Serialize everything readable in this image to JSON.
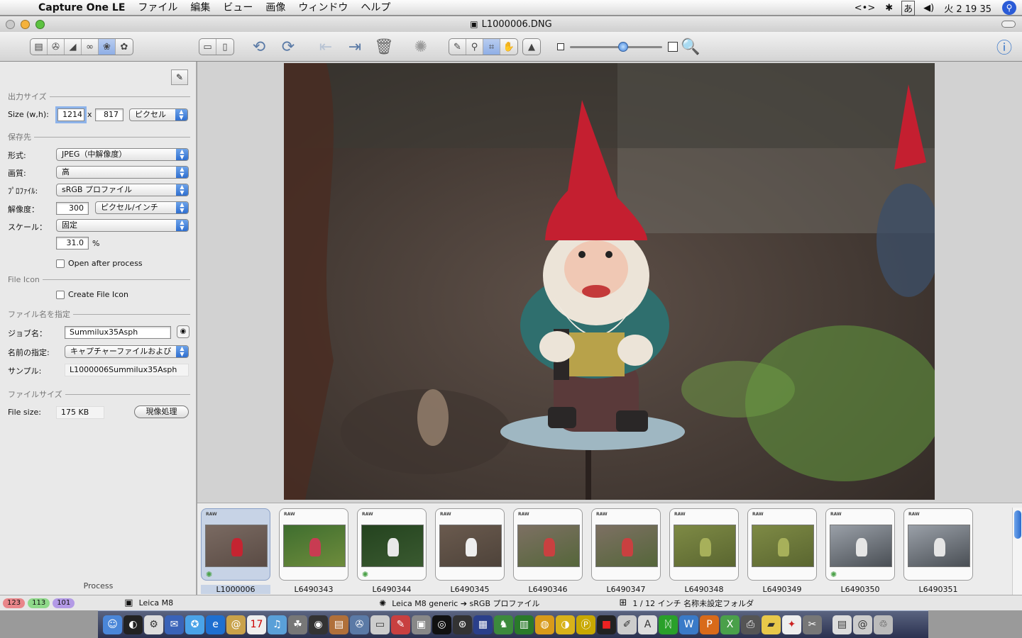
{
  "menubar": {
    "app_name": "Capture One LE",
    "items": [
      "ファイル",
      "編集",
      "ビュー",
      "画像",
      "ウィンドウ",
      "ヘルプ"
    ],
    "clock": "火 2 19 35",
    "input_mode": "あ"
  },
  "window": {
    "title": "L1000006.DNG"
  },
  "sidebar": {
    "output_size": {
      "section": "出力サイズ",
      "label": "Size (w,h):",
      "width": "1214",
      "sep": "x",
      "height": "817",
      "unit": "ピクセル"
    },
    "destination": {
      "section": "保存先",
      "format_label": "形式:",
      "format": "JPEG（中解像度）",
      "quality_label": "画質:",
      "quality": "高",
      "profile_label": "ﾌﾟﾛﾌｧｲﾙ:",
      "profile": "sRGB プロファイル",
      "resolution_label": "解像度：",
      "resolution": "300",
      "resolution_unit": "ピクセル/インチ",
      "scale_label": "スケール：",
      "scale": "固定",
      "scale_percent": "31.0",
      "percent_sign": "%",
      "open_after": "Open after process"
    },
    "file_icon": {
      "section": "File Icon",
      "create": "Create File Icon"
    },
    "naming": {
      "section": "ファイル名を指定",
      "job_label": "ジョブ名：",
      "job_name": "Summilux35Asph",
      "naming_label": "名前の指定:",
      "naming_value": "キャプチャーファイルおよび",
      "sample_label": "サンプル:",
      "sample": "L1000006Summilux35Asph"
    },
    "file_size": {
      "section": "ファイルサイズ",
      "label": "File size:",
      "value": "175 KB",
      "process_button": "現像処理"
    },
    "footer": "Process"
  },
  "filmstrip": {
    "raw_tag": "RAW",
    "thumbs": [
      {
        "name": "L1000006",
        "selected": true,
        "processed": true,
        "colors": [
          "#7a6a62",
          "#c52431",
          "#5a4b44"
        ]
      },
      {
        "name": "L6490343",
        "selected": false,
        "processed": false,
        "colors": [
          "#3f6e2f",
          "#c83c52",
          "#6e8c3c"
        ]
      },
      {
        "name": "L6490344",
        "selected": false,
        "processed": true,
        "colors": [
          "#24431f",
          "#e8e8e8",
          "#3a5a30"
        ]
      },
      {
        "name": "L6490345",
        "selected": false,
        "processed": false,
        "colors": [
          "#6a5a4e",
          "#eeeeee",
          "#4e433a"
        ]
      },
      {
        "name": "L6490346",
        "selected": false,
        "processed": false,
        "colors": [
          "#7d7063",
          "#c94040",
          "#55663a"
        ]
      },
      {
        "name": "L6490347",
        "selected": false,
        "processed": false,
        "colors": [
          "#7d7063",
          "#c94040",
          "#55663a"
        ]
      },
      {
        "name": "L6490348",
        "selected": false,
        "processed": false,
        "colors": [
          "#7e8a45",
          "#a7b05a",
          "#5a6630"
        ]
      },
      {
        "name": "L6490349",
        "selected": false,
        "processed": false,
        "colors": [
          "#7e8a45",
          "#a7b05a",
          "#5a6630"
        ]
      },
      {
        "name": "L6490350",
        "selected": false,
        "processed": true,
        "colors": [
          "#9aa0a8",
          "#e5e5e5",
          "#4a4f55"
        ]
      },
      {
        "name": "L6490351",
        "selected": false,
        "processed": false,
        "colors": [
          "#9aa0a8",
          "#e5e5e5",
          "#4a4f55"
        ]
      }
    ]
  },
  "statusbar": {
    "counts": [
      {
        "value": "123",
        "color": "#e9868a"
      },
      {
        "value": "113",
        "color": "#8fd98a"
      },
      {
        "value": "101",
        "color": "#b39ae6"
      }
    ],
    "camera": "Leica M8",
    "profile": "Leica M8 generic ➔ sRGB プロファイル",
    "info": "1 / 12 インチ 名称未設定フォルダ"
  }
}
